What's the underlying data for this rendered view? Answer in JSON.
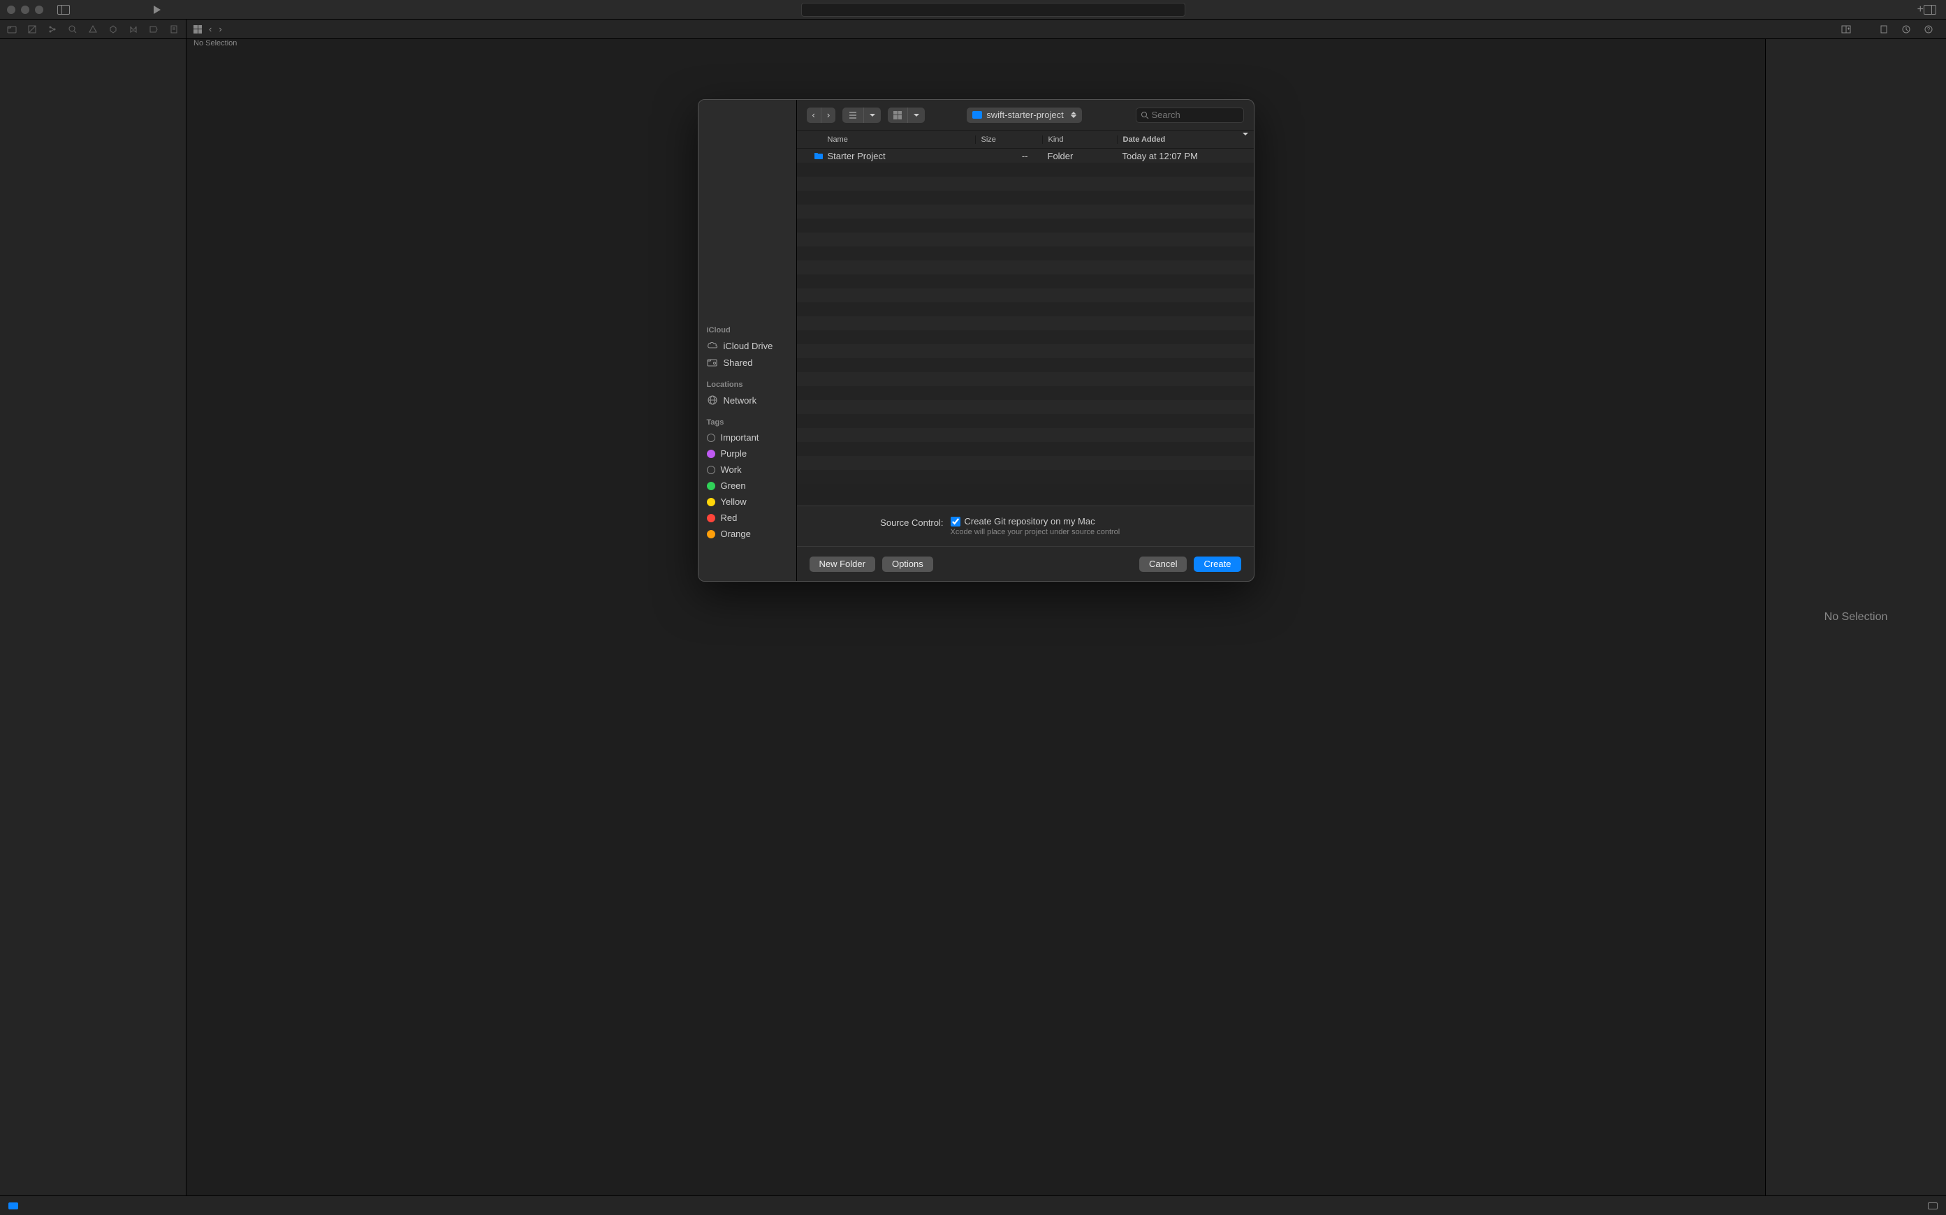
{
  "titlebar": {},
  "jump_bar": {
    "text": "No Selection"
  },
  "inspector": {
    "placeholder": "No Selection"
  },
  "save_panel": {
    "toolbar": {
      "path": "swift-starter-project",
      "search_placeholder": "Search"
    },
    "columns": {
      "name": "Name",
      "size": "Size",
      "kind": "Kind",
      "date_added": "Date Added"
    },
    "rows": [
      {
        "name": "Starter Project",
        "size": "--",
        "kind": "Folder",
        "date_added": "Today at 12:07 PM"
      }
    ],
    "sidebar": {
      "icloud": {
        "title": "iCloud",
        "items": [
          {
            "label": "iCloud Drive",
            "icon": "cloud"
          },
          {
            "label": "Shared",
            "icon": "shared-folder"
          }
        ]
      },
      "locations": {
        "title": "Locations",
        "items": [
          {
            "label": "Network",
            "icon": "globe"
          }
        ]
      },
      "tags": {
        "title": "Tags",
        "items": [
          {
            "label": "Important",
            "color": "#888",
            "filled": false
          },
          {
            "label": "Purple",
            "color": "#bf5af2",
            "filled": true
          },
          {
            "label": "Work",
            "color": "#888",
            "filled": false
          },
          {
            "label": "Green",
            "color": "#30d158",
            "filled": true
          },
          {
            "label": "Yellow",
            "color": "#ffd60a",
            "filled": true
          },
          {
            "label": "Red",
            "color": "#ff453a",
            "filled": true
          },
          {
            "label": "Orange",
            "color": "#ff9f0a",
            "filled": true
          }
        ]
      }
    },
    "options": {
      "label": "Source Control:",
      "checkbox_label": "Create Git repository on my Mac",
      "checkbox_checked": true,
      "hint": "Xcode will place your project under source control"
    },
    "footer": {
      "new_folder": "New Folder",
      "options": "Options",
      "cancel": "Cancel",
      "create": "Create"
    }
  }
}
